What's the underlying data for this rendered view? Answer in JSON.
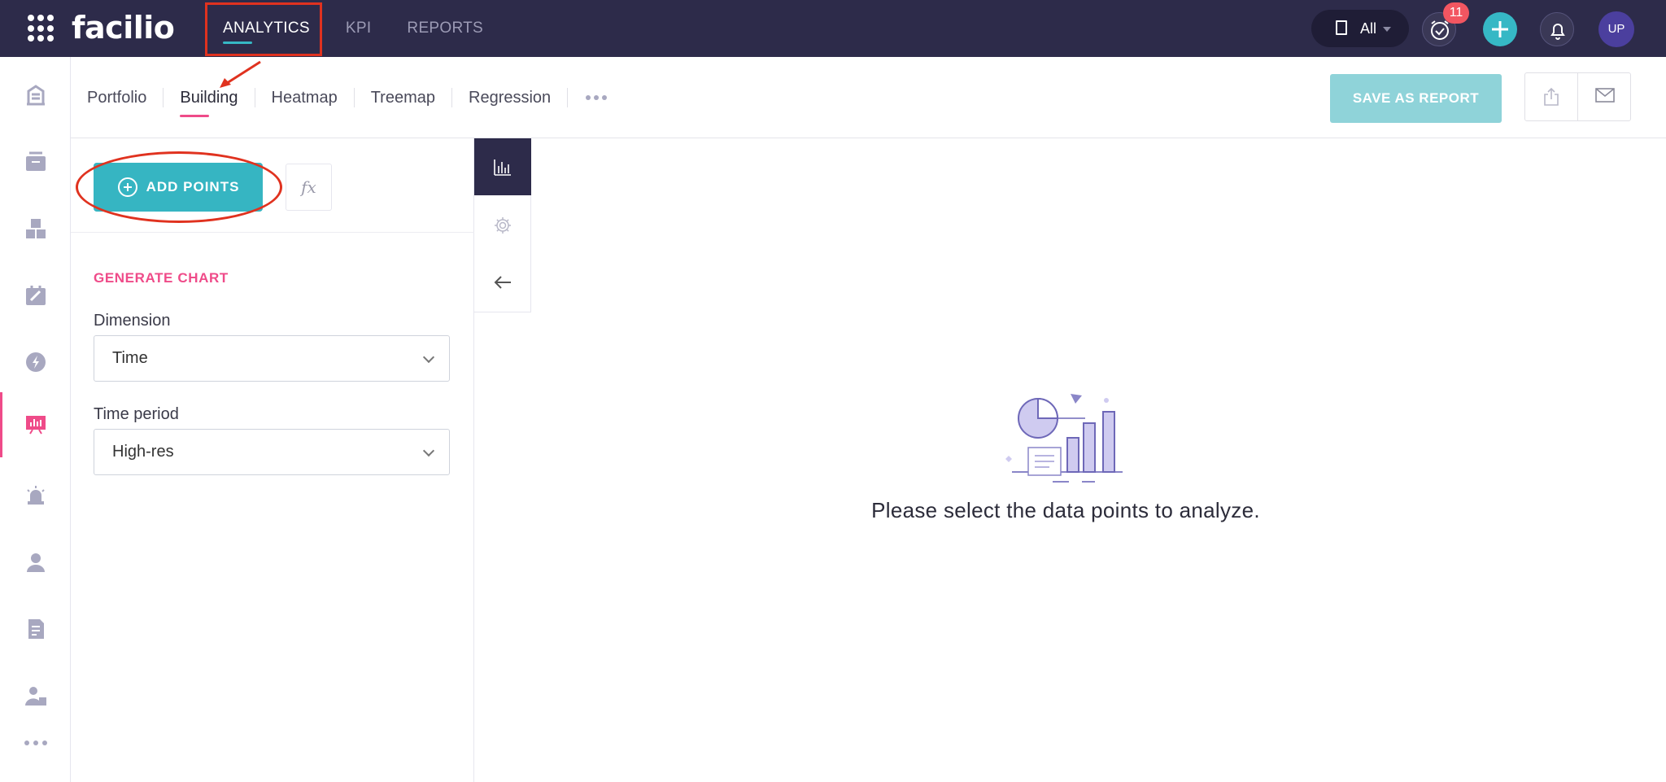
{
  "app": {
    "logo": "facilio"
  },
  "topnav": {
    "items": [
      {
        "label": "ANALYTICS",
        "active": true
      },
      {
        "label": "KPI",
        "active": false
      },
      {
        "label": "REPORTS",
        "active": false
      }
    ]
  },
  "topbar": {
    "site_filter": "All",
    "alarm_count": "11",
    "avatar_initials": "UP"
  },
  "sidebar": {
    "icons": [
      "building-stack-icon",
      "inbox-icon",
      "assets-icon",
      "workorder-tools-icon",
      "energy-icon",
      "analytics-board-icon",
      "alarm-siren-icon",
      "people-icon",
      "invoice-icon",
      "technician-icon"
    ],
    "active_index": 5
  },
  "subtabs": {
    "items": [
      {
        "label": "Portfolio",
        "active": false
      },
      {
        "label": "Building",
        "active": true
      },
      {
        "label": "Heatmap",
        "active": false
      },
      {
        "label": "Treemap",
        "active": false
      },
      {
        "label": "Regression",
        "active": false
      }
    ]
  },
  "toolbar": {
    "save_report": "SAVE AS REPORT"
  },
  "config": {
    "add_points": "ADD POINTS",
    "fx": "fx",
    "section_title": "GENERATE CHART",
    "dimension_label": "Dimension",
    "dimension_value": "Time",
    "time_period_label": "Time period",
    "time_period_value": "High-res"
  },
  "empty_state": {
    "message": "Please select the data points to analyze."
  },
  "colors": {
    "topbar": "#2d2b4a",
    "accent_teal": "#36b5c2",
    "accent_pink": "#ef4b89",
    "annotation_red": "#e0321f"
  }
}
